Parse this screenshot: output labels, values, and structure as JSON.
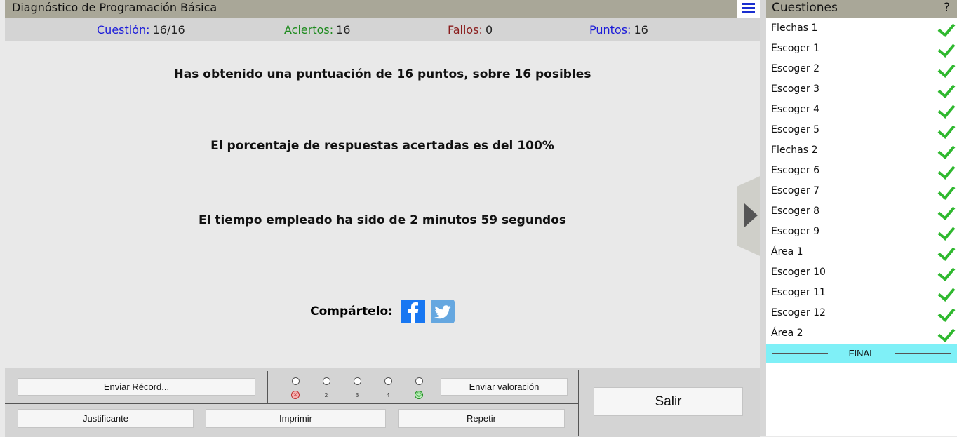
{
  "app": {
    "title": "Diagnóstico de Programación Básica"
  },
  "stats": {
    "question_label": "Cuestión:",
    "question_value": "16/16",
    "question_color": "#1b1bd9",
    "correct_label": "Aciertos:",
    "correct_value": "16",
    "correct_color": "#1d8a1d",
    "wrong_label": "Fallos:",
    "wrong_value": "0",
    "wrong_color": "#8a1d1d",
    "points_label": "Puntos:",
    "points_value": "16",
    "points_color": "#1b1bd9"
  },
  "results": {
    "score_line": "Has obtenido una puntuación de 16 puntos, sobre 16 posibles",
    "percent_line": "El porcentaje de respuestas acertadas es del 100%",
    "time_line": "El tiempo empleado ha sido de 2 minutos 59 segundos",
    "share_label": "Compártelo:"
  },
  "buttons": {
    "send_record": "Enviar Récord...",
    "send_rating": "Enviar valoración",
    "receipt": "Justificante",
    "print": "Imprimir",
    "repeat": "Repetir",
    "exit": "Salir"
  },
  "rating": {
    "labels": [
      "2",
      "3",
      "4"
    ]
  },
  "sidebar": {
    "title": "Cuestiones",
    "help": "?",
    "items": [
      {
        "label": "Flechas 1"
      },
      {
        "label": "Escoger 1"
      },
      {
        "label": "Escoger 2"
      },
      {
        "label": "Escoger 3"
      },
      {
        "label": "Escoger 4"
      },
      {
        "label": "Escoger 5"
      },
      {
        "label": "Flechas 2"
      },
      {
        "label": "Escoger 6"
      },
      {
        "label": "Escoger 7"
      },
      {
        "label": "Escoger 8"
      },
      {
        "label": "Escoger 9"
      },
      {
        "label": "Área 1"
      },
      {
        "label": "Escoger 10"
      },
      {
        "label": "Escoger 11"
      },
      {
        "label": "Escoger 12"
      },
      {
        "label": "Área 2"
      }
    ],
    "final_label": "FINAL"
  }
}
